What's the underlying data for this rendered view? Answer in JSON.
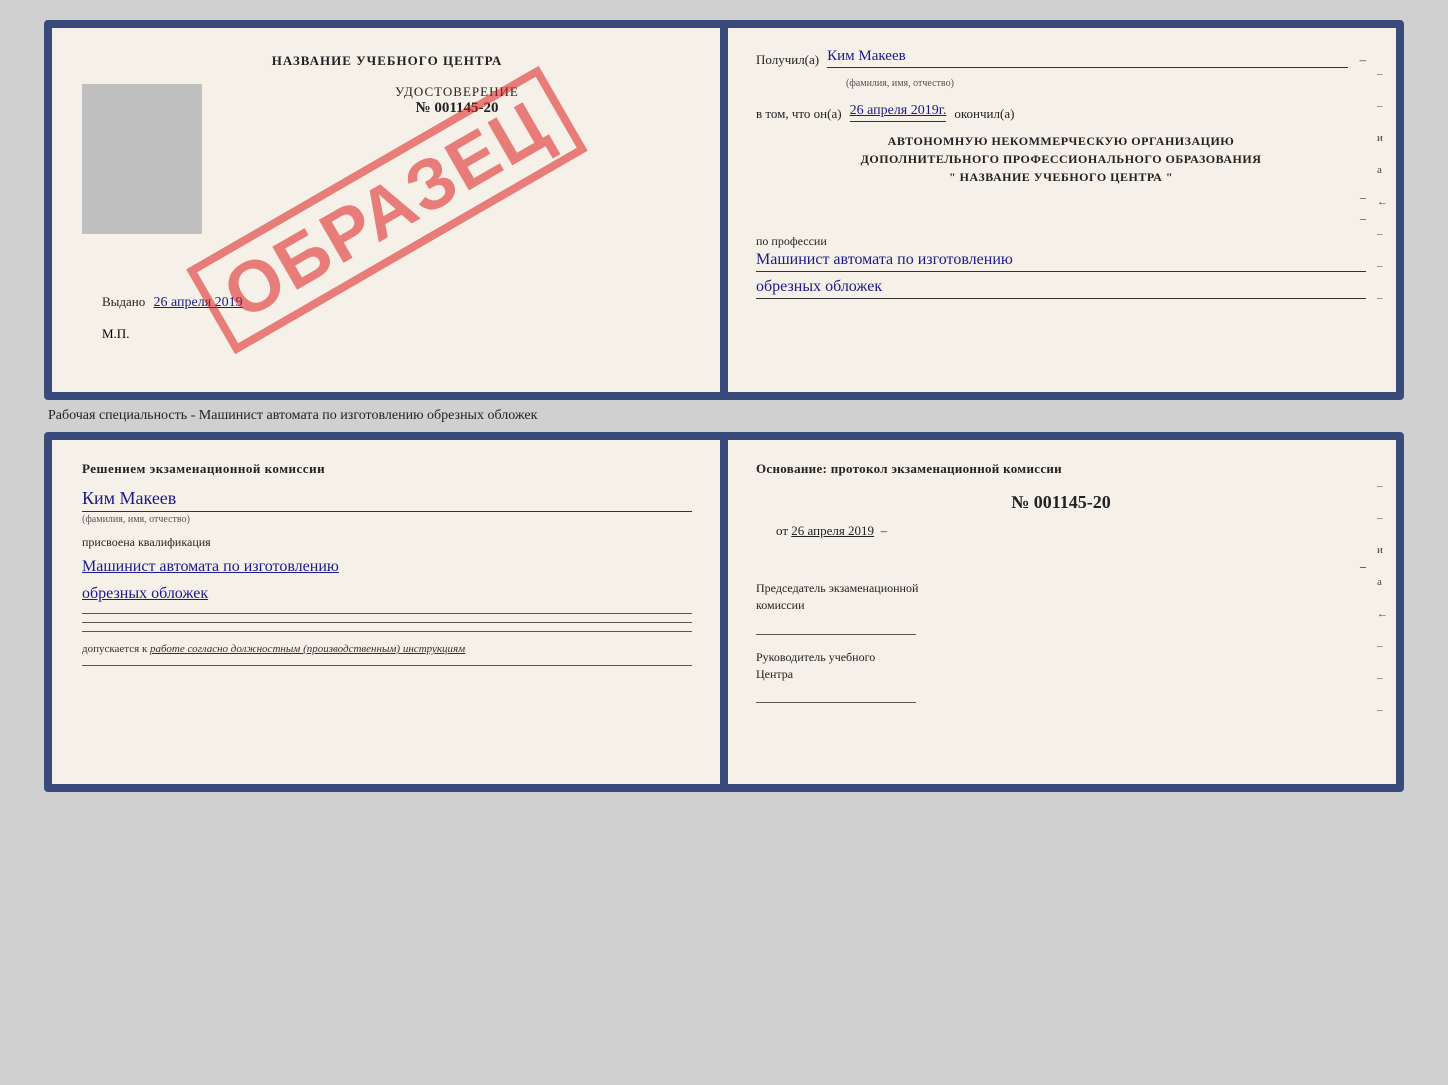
{
  "top_cert": {
    "left": {
      "title": "НАЗВАНИЕ УЧЕБНОГО ЦЕНТРА",
      "stamp": "ОБРАЗЕЦ",
      "cert_label": "УДОСТОВЕРЕНИЕ",
      "cert_number": "№ 001145-20",
      "issued_label": "Выдано",
      "issued_date": "26 апреля 2019",
      "mp_label": "М.П."
    },
    "right": {
      "received_label": "Получил(а)",
      "received_name": "Ким Макеев",
      "name_sublabel": "(фамилия, имя, отчество)",
      "dash1": "–",
      "date_intro": "в том, что он(а)",
      "date_value": "26 апреля 2019г.",
      "finished_label": "окончил(а)",
      "org_line1": "АВТОНОМНУЮ НЕКОММЕРЧЕСКУЮ ОРГАНИЗАЦИЮ",
      "org_line2": "ДОПОЛНИТЕЛЬНОГО ПРОФЕССИОНАЛЬНОГО ОБРАЗОВАНИЯ",
      "org_quote_open": "\"",
      "org_name": "НАЗВАНИЕ УЧЕБНОГО ЦЕНТРА",
      "org_quote_close": "\"",
      "dash2": "–",
      "dash3": "–",
      "profession_label": "по профессии",
      "profession_line1": "Машинист автомата по изготовлению",
      "profession_line2": "обрезных обложек",
      "side_marks": [
        "–",
        "–",
        "и",
        "а",
        "←",
        "–",
        "–",
        "–"
      ]
    }
  },
  "separator": {
    "text": "Рабочая специальность - Машинист автомата по изготовлению обрезных обложек"
  },
  "bottom_cert": {
    "left": {
      "heading": "Решением экзаменационной комиссии",
      "name_value": "Ким Макеев",
      "name_sublabel": "(фамилия, имя, отчество)",
      "kvali_label": "присвоена квалификация",
      "kvali_line1": "Машинист автомата по изготовлению",
      "kvali_line2": "обрезных обложек",
      "dopusk_prefix": "допускается к",
      "dopusk_italic": "работе согласно должностным (производственным) инструкциям"
    },
    "right": {
      "heading": "Основание: протокол экзаменационной комиссии",
      "number_label": "№",
      "number_value": "001145-20",
      "date_prefix": "от",
      "date_value": "26 апреля 2019",
      "dash_after_date": "–",
      "dash2": "–",
      "chair_label1": "Председатель экзаменационной",
      "chair_label2": "комиссии",
      "side_and": "и",
      "side_a": "а",
      "side_arrow": "←",
      "head_label1": "Руководитель учебного",
      "head_label2": "Центра",
      "side_marks": [
        "–",
        "–",
        "и",
        "а",
        "←",
        "–",
        "–",
        "–"
      ]
    }
  }
}
